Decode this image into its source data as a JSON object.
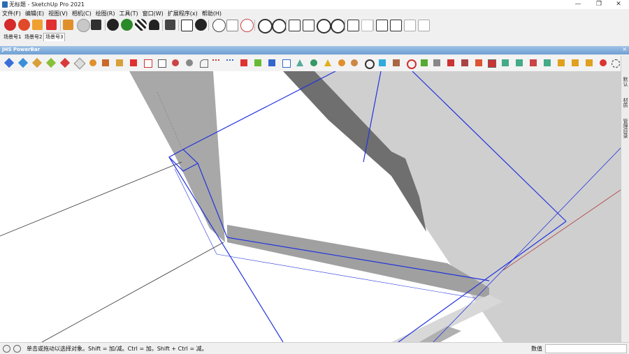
{
  "window": {
    "title": "无标题 - SketchUp Pro 2021",
    "controls": {
      "minimize": "—",
      "maximize": "❐",
      "close": "✕"
    }
  },
  "menu": [
    "文件(F)",
    "编辑(E)",
    "视图(V)",
    "相机(C)",
    "绘图(R)",
    "工具(T)",
    "窗口(W)",
    "扩展程序(x)",
    "帮助(H)"
  ],
  "scene_tabs": [
    "场景号1",
    "场景号2",
    "场景号3"
  ],
  "active_scene": 2,
  "powerbar": {
    "title": "JHS PowerBar",
    "close": "×"
  },
  "tray": {
    "labels": [
      "默认",
      "材质",
      "管理目录"
    ]
  },
  "status": {
    "help_text": "单击或拖动以选择对象。Shift = 加/减。Ctrl = 加。Shift + Ctrl = 减。",
    "measurements_label": "数值",
    "measurements_value": ""
  }
}
